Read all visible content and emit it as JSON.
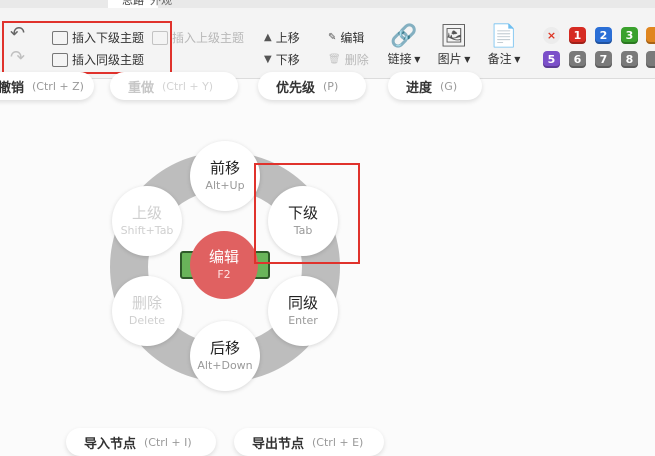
{
  "tabs": {
    "active": "思路",
    "second": "外观"
  },
  "toolbar": {
    "insert_child": "插入下级主题",
    "insert_parent": "插入上级主题",
    "insert_sibling": "插入同级主题",
    "move_up": "上移",
    "move_down": "下移",
    "edit": "编辑",
    "delete": "删除",
    "link": "链接",
    "image": "图片",
    "note": "备注",
    "priorities_row1": [
      "1",
      "2",
      "3"
    ],
    "priorities_row2": [
      "5",
      "6",
      "7",
      "8"
    ],
    "clear_priority": "×"
  },
  "pills": {
    "undo": {
      "label": "撤销",
      "key": "(Ctrl + Z)"
    },
    "redo": {
      "label": "重做",
      "key": "(Ctrl + Y)"
    },
    "priority": {
      "label": "优先级",
      "key": "(P)"
    },
    "progress": {
      "label": "进度",
      "key": "(G)"
    },
    "import_node": {
      "label": "导入节点",
      "key": "(Ctrl + I)"
    },
    "export_node": {
      "label": "导出节点",
      "key": "(Ctrl + E)"
    }
  },
  "radial": {
    "center": {
      "label": "编辑",
      "key": "F2"
    },
    "forward": {
      "label": "前移",
      "key": "Alt+Up"
    },
    "child": {
      "label": "下级",
      "key": "Tab"
    },
    "sibling": {
      "label": "同级",
      "key": "Enter"
    },
    "backward": {
      "label": "后移",
      "key": "Alt+Down"
    },
    "delete": {
      "label": "删除",
      "key": "Delete"
    },
    "parent": {
      "label": "上级",
      "key": "Shift+Tab"
    }
  },
  "colors": {
    "highlight_box": "#e0322c",
    "center_node": "#e06161",
    "selected_topic": "#69b45a",
    "ring": "#bdbdbd",
    "priority": [
      "#d62b22",
      "#2b6fd6",
      "#3aa12d",
      "#e0861f",
      "#7b4fc9",
      "#7a7a7a",
      "#7a7a7a",
      "#7a7a7a"
    ]
  }
}
